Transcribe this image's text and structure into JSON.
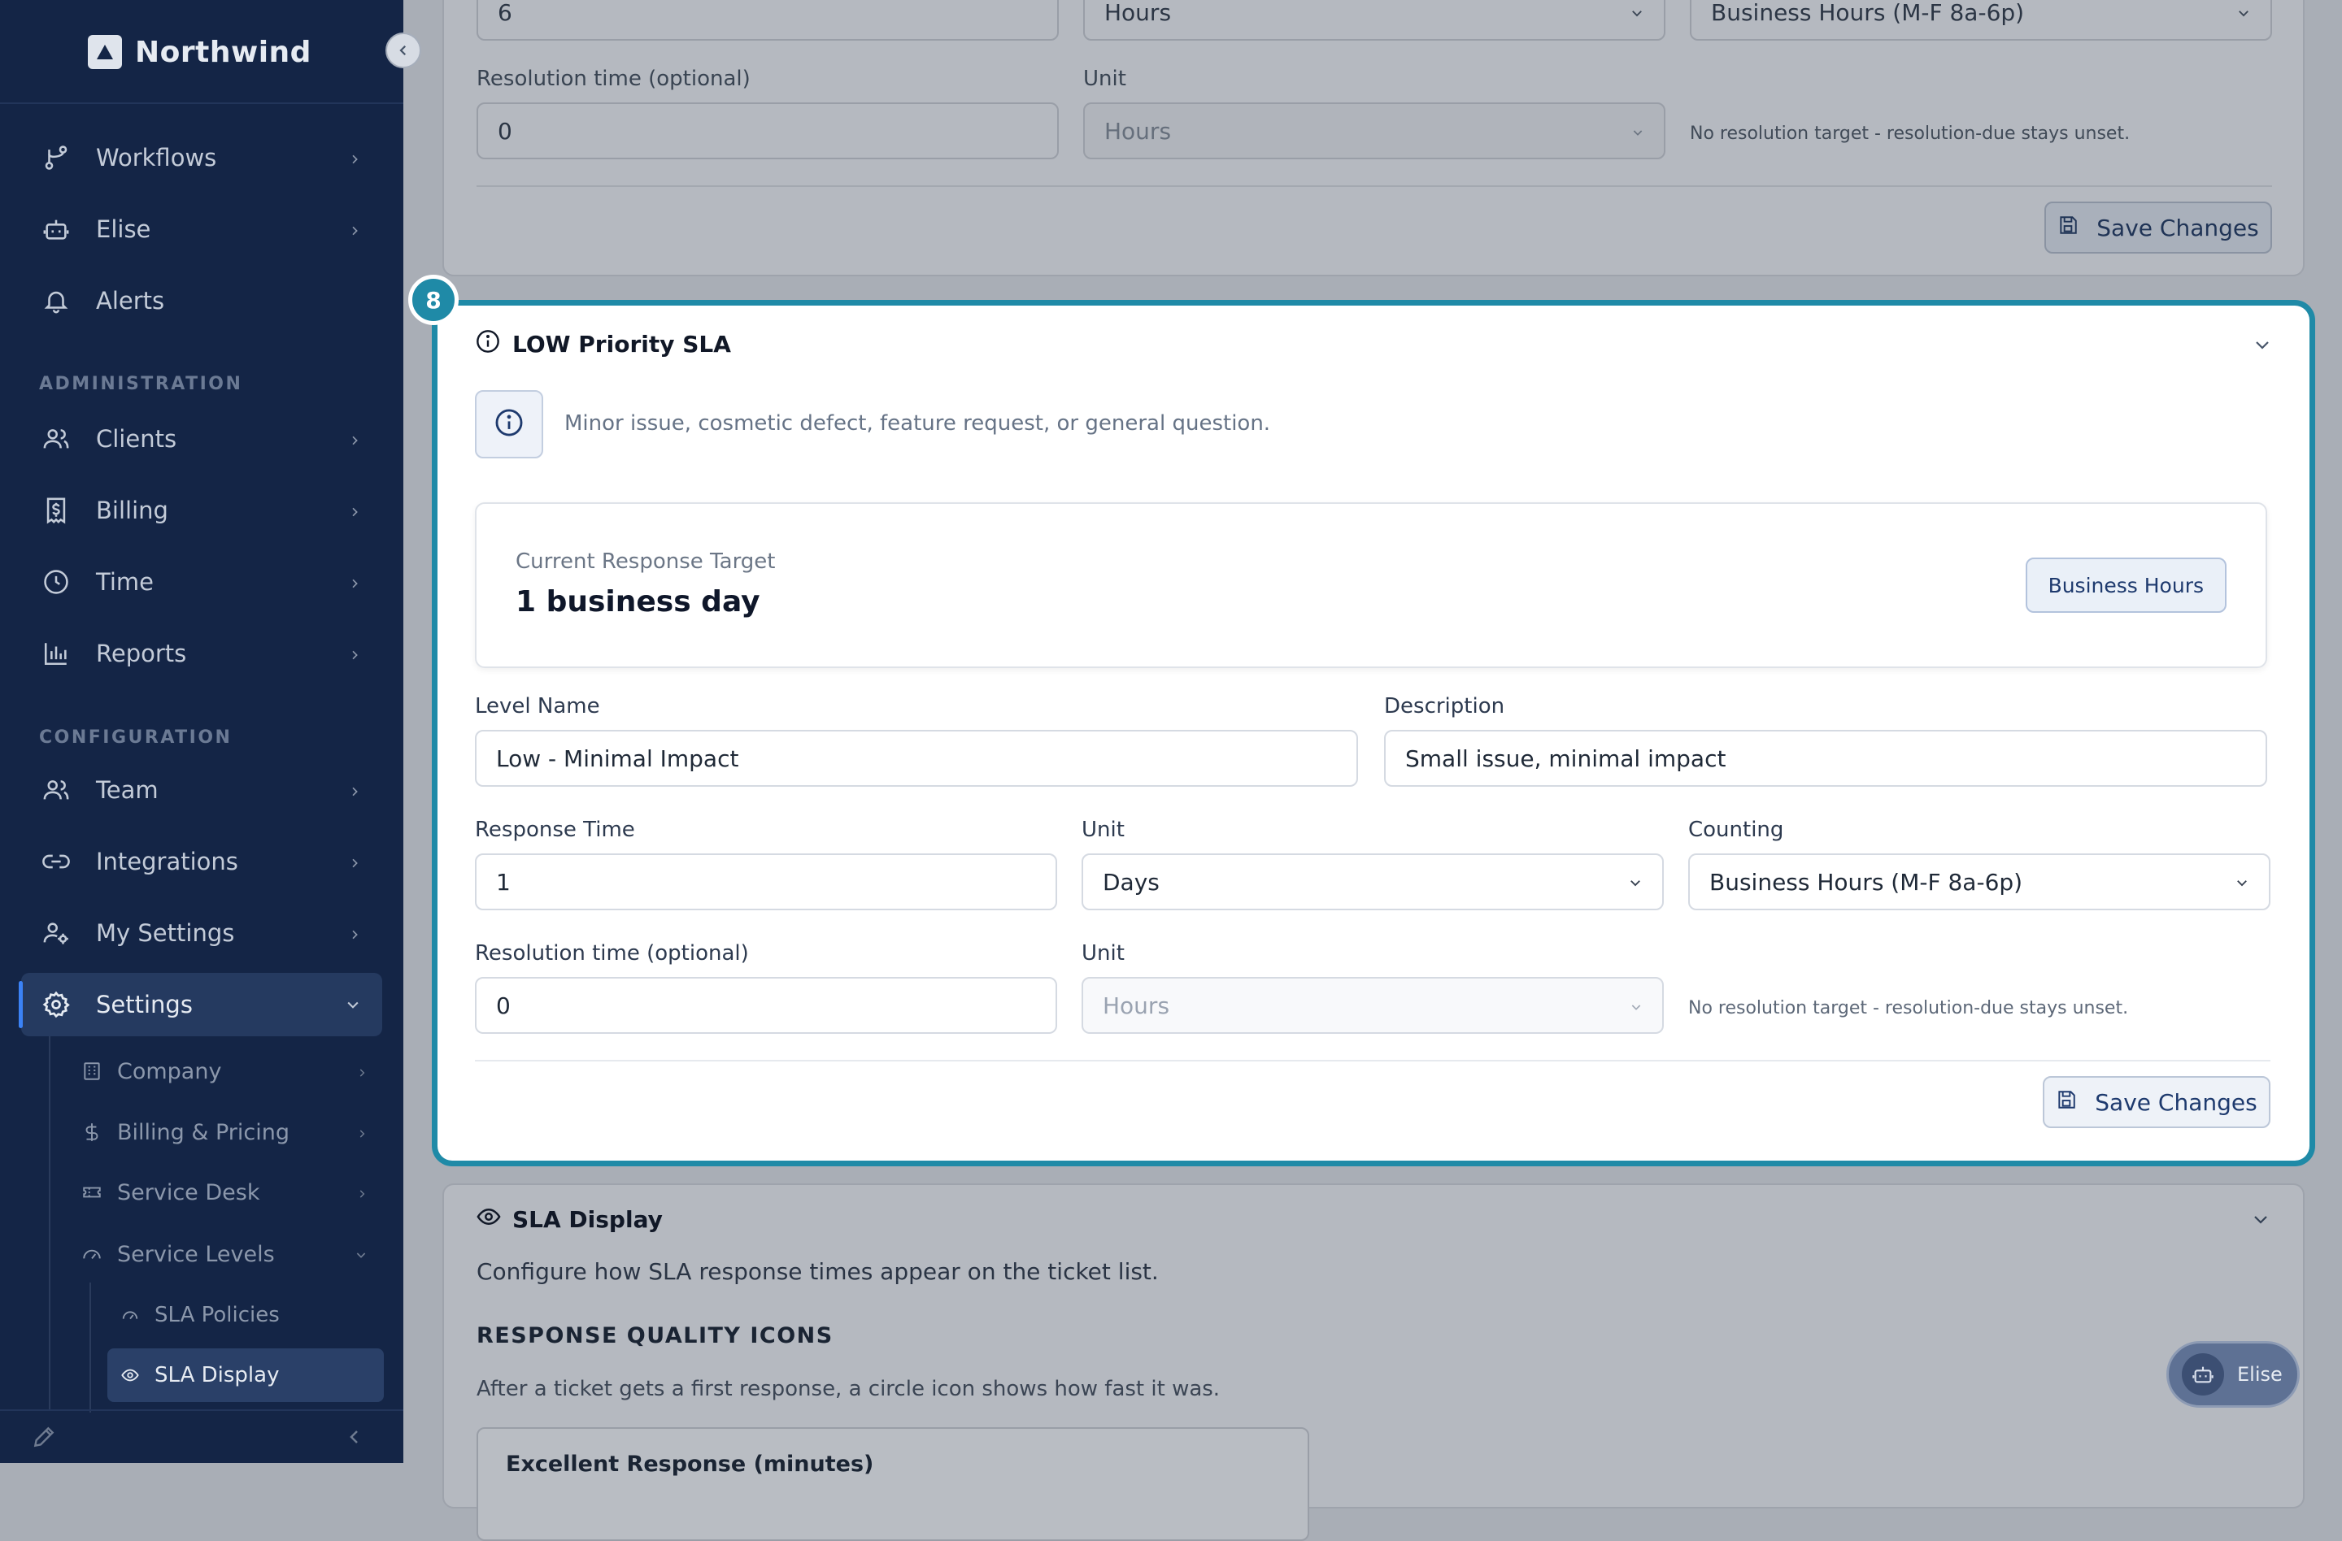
{
  "brand": {
    "name": "Northwind"
  },
  "sidebar": {
    "nav": [
      {
        "label": "Workflows",
        "icon": "workflow-icon"
      },
      {
        "label": "Elise",
        "icon": "bot-icon"
      },
      {
        "label": "Alerts",
        "icon": "bell-icon"
      }
    ],
    "section_admin": "ADMINISTRATION",
    "admin": [
      {
        "label": "Clients",
        "icon": "users-icon"
      },
      {
        "label": "Billing",
        "icon": "receipt-dollar-icon"
      },
      {
        "label": "Time",
        "icon": "clock-icon"
      },
      {
        "label": "Reports",
        "icon": "bar-chart-icon"
      }
    ],
    "section_config": "CONFIGURATION",
    "config": [
      {
        "label": "Team",
        "icon": "users-icon"
      },
      {
        "label": "Integrations",
        "icon": "link-icon"
      },
      {
        "label": "My Settings",
        "icon": "user-cog-icon"
      },
      {
        "label": "Settings",
        "icon": "gear-icon"
      }
    ],
    "settings_sub": [
      {
        "label": "Company",
        "icon": "building-icon"
      },
      {
        "label": "Billing & Pricing",
        "icon": "dollar-icon"
      },
      {
        "label": "Service Desk",
        "icon": "ticket-icon"
      },
      {
        "label": "Service Levels",
        "icon": "gauge-icon"
      }
    ],
    "service_levels_sub": [
      {
        "label": "SLA Policies",
        "icon": "gauge-icon"
      },
      {
        "label": "SLA Display",
        "icon": "eye-icon"
      }
    ]
  },
  "prev_card": {
    "response_value": "6",
    "unit_value": "Hours",
    "counting_value": "Business Hours (M-F 8a-6p)",
    "resolution_label": "Resolution time (optional)",
    "resolution_value": "0",
    "unit_label": "Unit",
    "resolution_unit_value": "Hours",
    "helper": "No resolution target - resolution-due stays unset.",
    "save_label": "Save Changes"
  },
  "low_card": {
    "step": "8",
    "title": "LOW Priority SLA",
    "info_text": "Minor issue, cosmetic defect, feature request, or general question.",
    "target_label": "Current Response Target",
    "target_value": "1 business day",
    "target_badge": "Business Hours",
    "level_name_label": "Level Name",
    "level_name_value": "Low - Minimal Impact",
    "description_label": "Description",
    "description_value": "Small issue, minimal impact",
    "response_label": "Response Time",
    "response_value": "1",
    "unit_label": "Unit",
    "unit_value": "Days",
    "counting_label": "Counting",
    "counting_value": "Business Hours (M-F 8a-6p)",
    "resolution_label": "Resolution time (optional)",
    "resolution_value": "0",
    "resolution_unit_label": "Unit",
    "resolution_unit_value": "Hours",
    "helper": "No resolution target - resolution-due stays unset.",
    "save_label": "Save Changes"
  },
  "display_card": {
    "title": "SLA Display",
    "subtitle": "Configure how SLA response times appear on the ticket list.",
    "section_heading": "RESPONSE QUALITY ICONS",
    "section_text": "After a ticket gets a first response, a circle icon shows how fast it was.",
    "field_label": "Excellent Response (minutes)"
  },
  "assistant": {
    "label": "Elise"
  },
  "colors": {
    "sidebar": "#142546",
    "accent": "#1f8aa7",
    "active_indicator": "#3b82f6"
  }
}
